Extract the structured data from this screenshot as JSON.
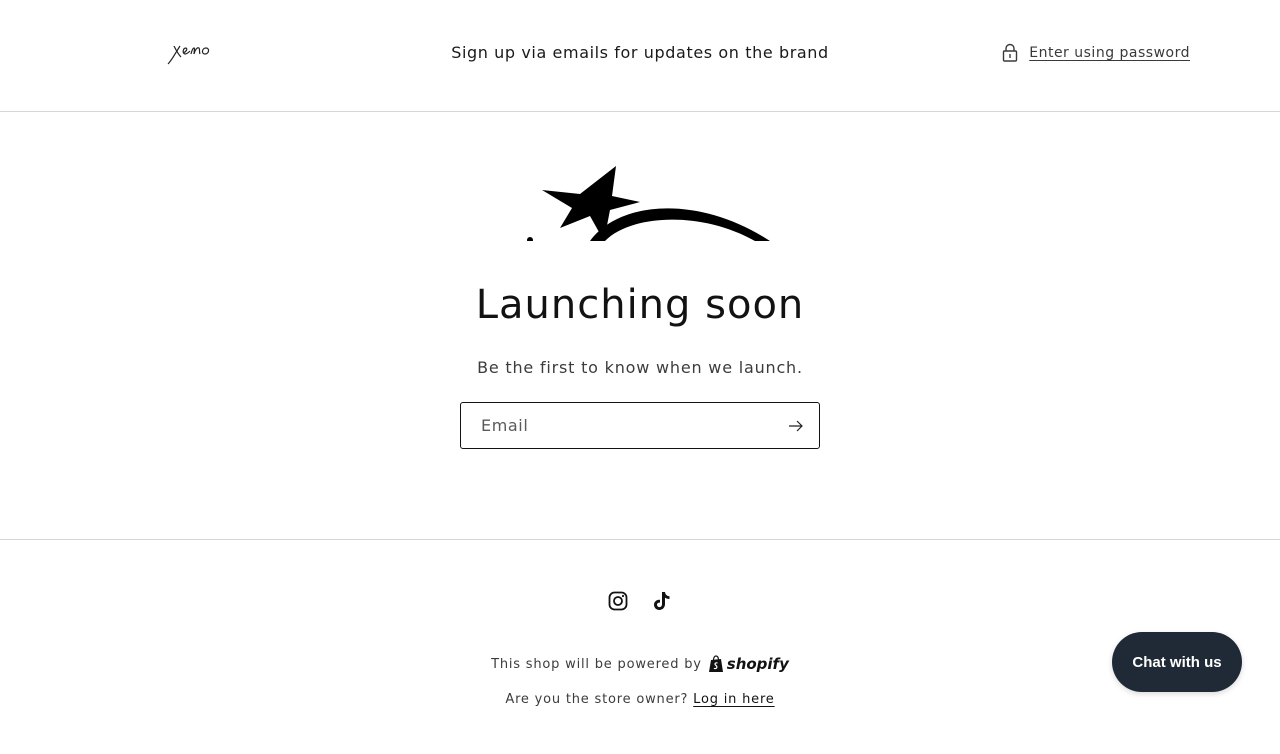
{
  "header": {
    "logo_alt": "xeno",
    "message": "Sign up via emails for updates on the brand",
    "password_link": "Enter using password"
  },
  "hero": {
    "heading": "Launching soon",
    "subheading": "Be the first to know when we launch.",
    "email_placeholder": "Email"
  },
  "footer": {
    "social": [
      {
        "name": "Instagram",
        "icon": "instagram-icon"
      },
      {
        "name": "TikTok",
        "icon": "tiktok-icon"
      }
    ],
    "powered_by": "This shop will be powered by",
    "shopify_word": "shopify",
    "owner_question": "Are you the store owner?",
    "login_link": "Log in here"
  },
  "chat": {
    "label": "Chat with us"
  },
  "colors": {
    "text": "#121212",
    "chat_bg": "#1f2a36",
    "divider": "#d6d6d6"
  }
}
